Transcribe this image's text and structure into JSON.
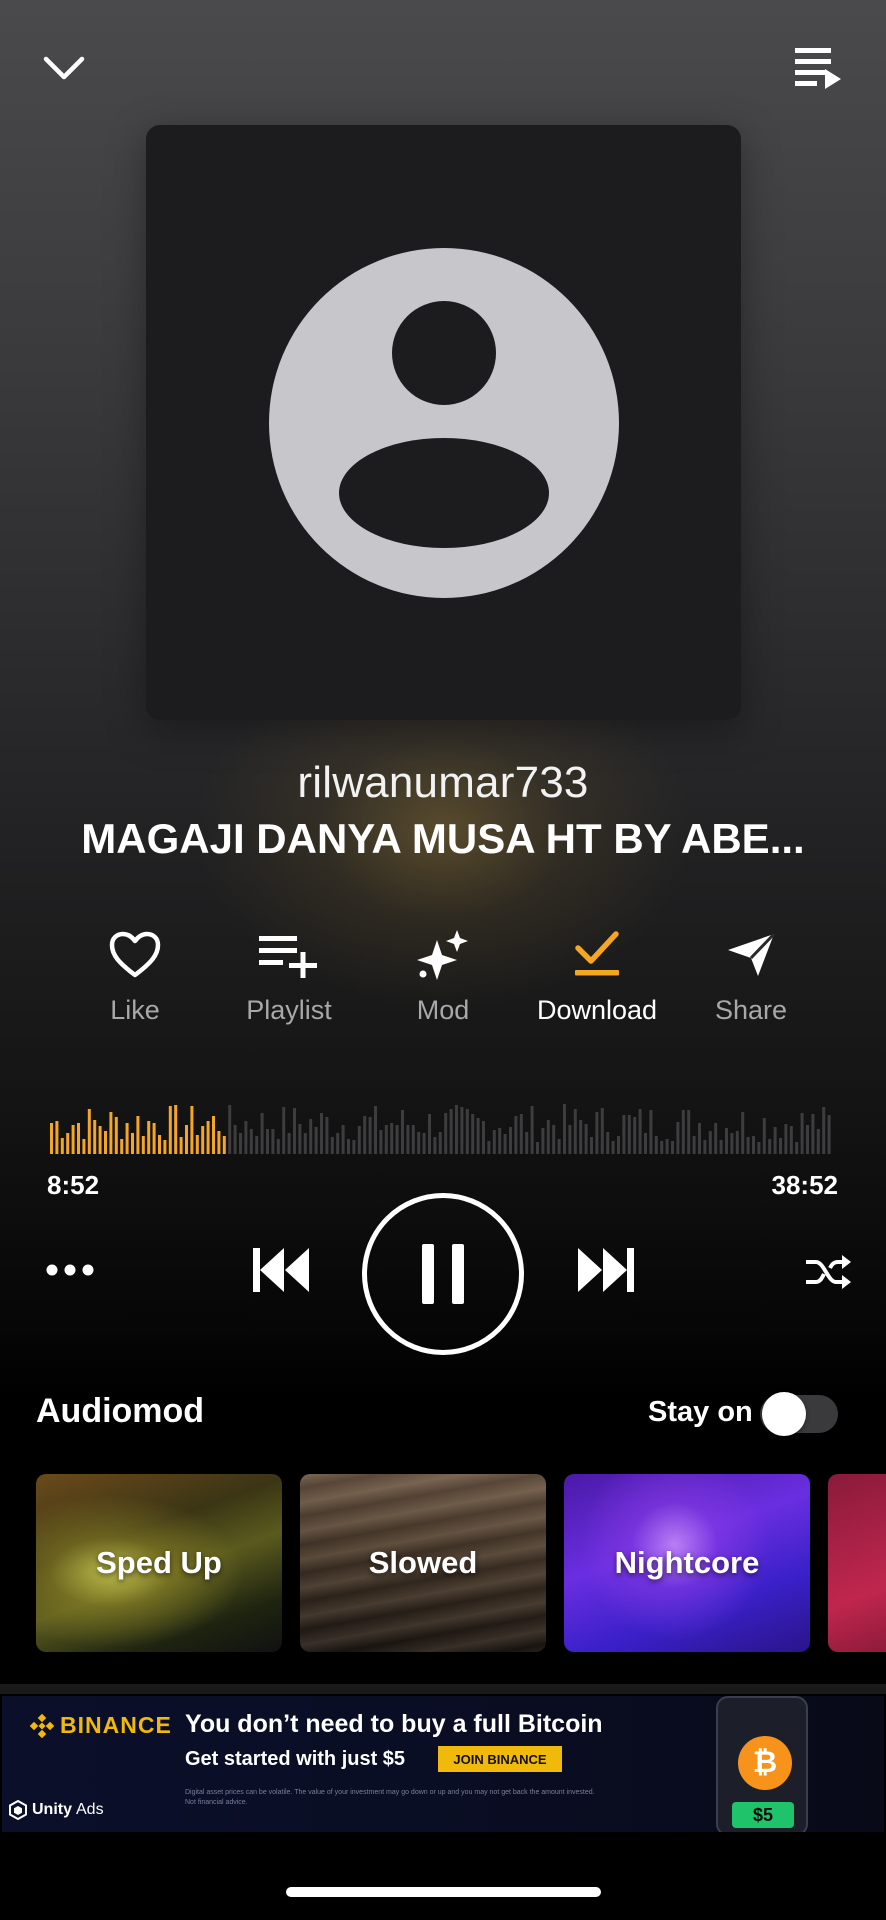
{
  "header": {
    "collapse_icon": "chevron-down-icon",
    "queue_icon": "queue-list-icon"
  },
  "track": {
    "artist": "rilwanumar733",
    "title": "MAGAJI DANYA MUSA HT  BY ABE..."
  },
  "actions": [
    {
      "label": "Like",
      "icon": "heart-icon"
    },
    {
      "label": "Playlist",
      "icon": "playlist-add-icon"
    },
    {
      "label": "Mod",
      "icon": "sparkle-icon"
    },
    {
      "label": "Download",
      "icon": "download-check-icon"
    },
    {
      "label": "Share",
      "icon": "send-icon"
    }
  ],
  "player": {
    "elapsed": "8:52",
    "total": "38:52",
    "progress": 0.228,
    "accent_color": "#f5a623",
    "state": "playing"
  },
  "audiomod": {
    "title": "Audiomod",
    "stay_on_label": "Stay on",
    "stay_on": false,
    "cards": [
      "Sped Up",
      "Slowed",
      "Nightcore"
    ]
  },
  "ad": {
    "brand": "BINANCE",
    "headline": "You don’t need to buy a full Bitcoin",
    "subline": "Get started with just $5",
    "cta": "JOIN BINANCE",
    "fine_print": "Digital asset prices can be volatile. The value of your investment may go down or up and you may not get back the amount invested. Not financial advice.",
    "network": "Unity",
    "network_suffix": "Ads",
    "coin_symbol": "₿",
    "amount_badge": "$5"
  }
}
